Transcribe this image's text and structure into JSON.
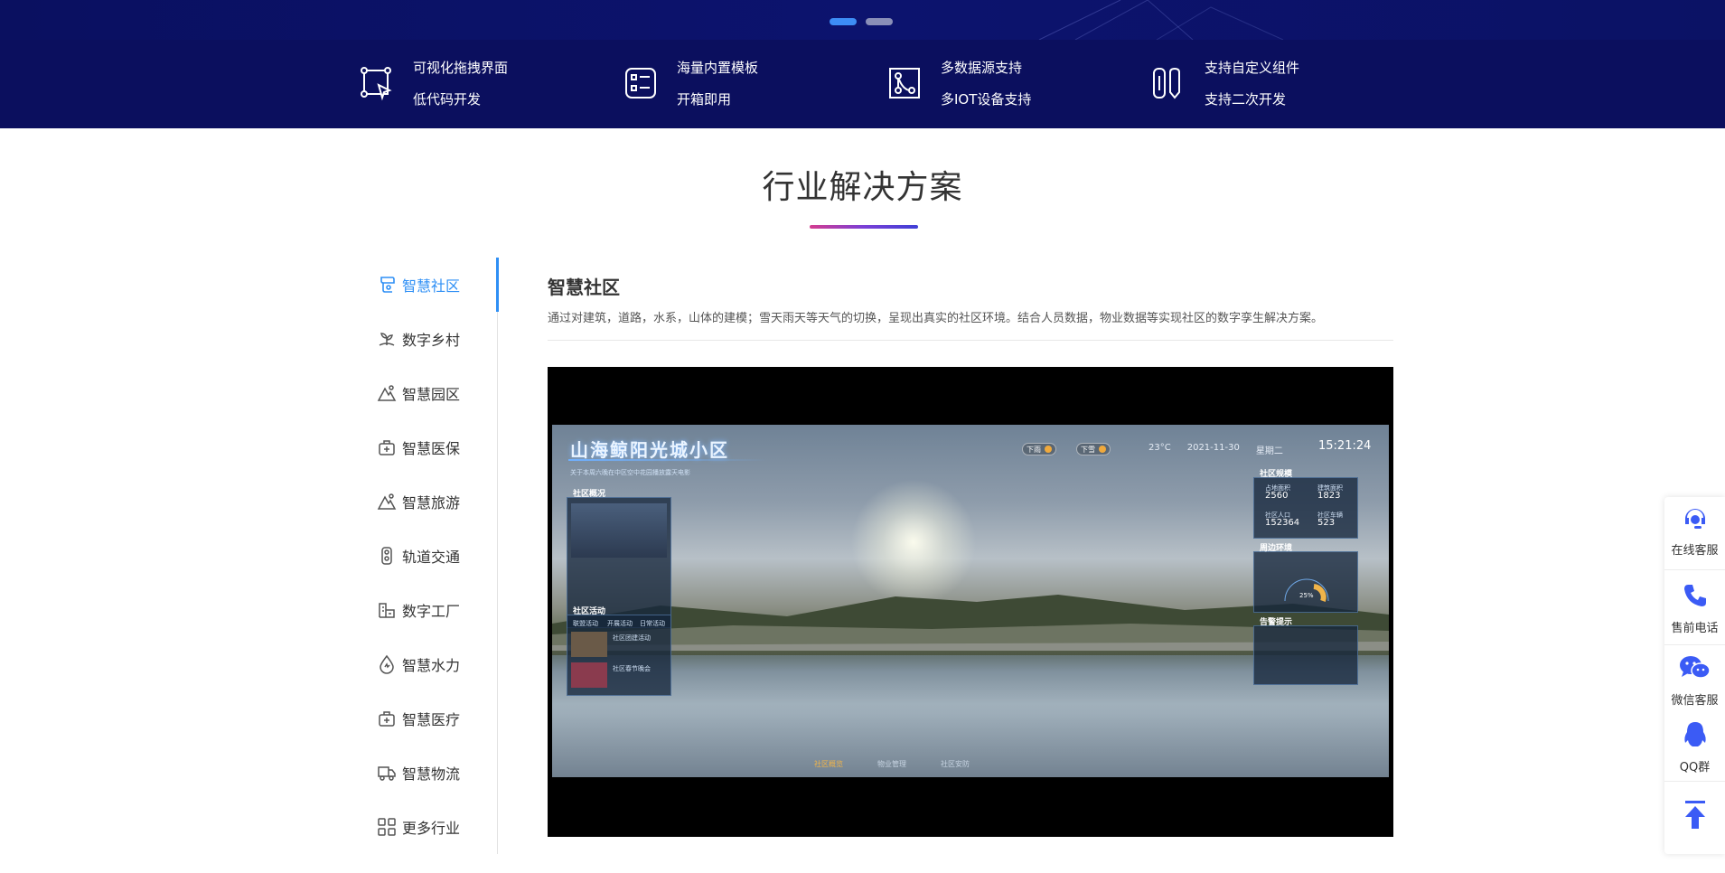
{
  "carousel": {
    "dots": [
      "slide-1",
      "slide-2"
    ],
    "active_index": 0
  },
  "features": [
    {
      "icon": "drag-select-icon",
      "line1": "可视化拖拽界面",
      "line2": "低代码开发"
    },
    {
      "icon": "template-list-icon",
      "line1": "海量内置模板",
      "line2": "开箱即用"
    },
    {
      "icon": "data-source-icon",
      "line1": "多数据源支持",
      "line2": "多IOT设备支持"
    },
    {
      "icon": "custom-component-icon",
      "line1": "支持自定义组件",
      "line2": "支持二次开发"
    }
  ],
  "section": {
    "title": "行业解决方案"
  },
  "sidebar": {
    "items": [
      {
        "label": "智慧社区",
        "icon": "community-icon",
        "active": true
      },
      {
        "label": "数字乡村",
        "icon": "village-sprout-icon"
      },
      {
        "label": "智慧园区",
        "icon": "park-mountain-icon"
      },
      {
        "label": "智慧医保",
        "icon": "medical-insurance-icon"
      },
      {
        "label": "智慧旅游",
        "icon": "tourism-mountain-icon"
      },
      {
        "label": "轨道交通",
        "icon": "traffic-light-icon"
      },
      {
        "label": "数字工厂",
        "icon": "factory-icon"
      },
      {
        "label": "智慧水力",
        "icon": "water-drop-icon"
      },
      {
        "label": "智慧医疗",
        "icon": "medical-kit-icon"
      },
      {
        "label": "智慧物流",
        "icon": "truck-icon"
      },
      {
        "label": "更多行业",
        "icon": "grid-more-icon"
      }
    ]
  },
  "content": {
    "title": "智慧社区",
    "description": "通过对建筑，道路，水系，山体的建模；雪天雨天等天气的切换，呈现出真实的社区环境。结合人员数据，物业数据等实现社区的数字孪生解决方案。"
  },
  "preview": {
    "title": "山海鲸阳光城小区",
    "toggle1": "下雨",
    "toggle2": "下雪",
    "temperature": "23°C",
    "date": "2021-11-30",
    "weekday": "星期二",
    "time": "15:21:24",
    "notice": "关于本周六晚在中区空中花园播放露天电影",
    "left_panel": {
      "overview": "社区概况",
      "activities": "社区活动",
      "tabs": [
        "联盟活动",
        "开展活动",
        "日常活动"
      ],
      "activity1": "社区团建活动",
      "activity2": "社区春节晚会"
    },
    "right_panel": {
      "head": "社区规模",
      "stats": [
        {
          "label": "占地面积",
          "value": "2560"
        },
        {
          "label": "建筑面积",
          "value": "1823"
        },
        {
          "label": "社区人口",
          "value": "152364"
        },
        {
          "label": "社区车辆",
          "value": "523"
        }
      ],
      "environment": "周边环境",
      "gauge_value": "25%",
      "alerts": "告警提示"
    },
    "nav": [
      "社区概览",
      "物业管理",
      "社区安防"
    ]
  },
  "float_bar": {
    "items": [
      {
        "label": "在线客服",
        "icon": "headset-icon"
      },
      {
        "label": "售前电话",
        "icon": "phone-icon"
      },
      {
        "label": "微信客服",
        "icon": "wechat-icon"
      },
      {
        "label": "QQ群",
        "icon": "qq-penguin-icon"
      },
      {
        "label": "",
        "icon": "back-to-top-icon"
      }
    ]
  },
  "colors": {
    "accent": "#2e8ff5",
    "banner": "#0b0f5e",
    "float_icon": "#3b5bf5"
  }
}
